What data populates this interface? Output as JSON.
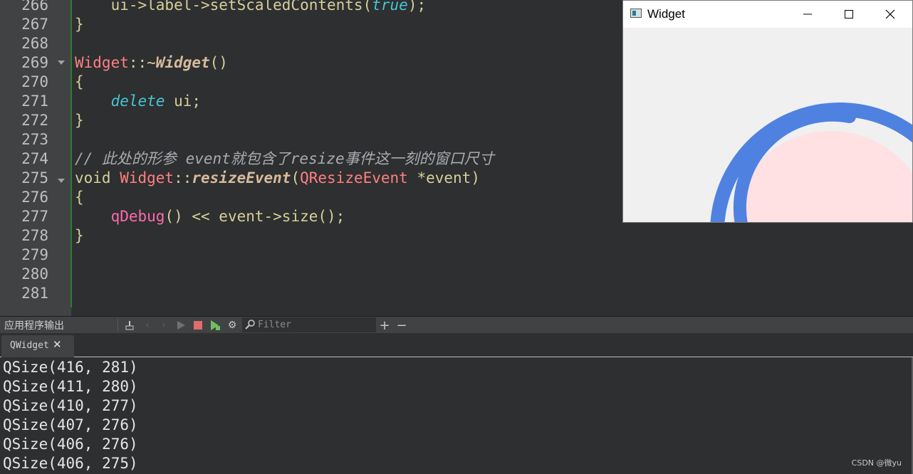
{
  "editor": {
    "line_numbers": [
      "266",
      "267",
      "268",
      "269",
      "270",
      "271",
      "272",
      "273",
      "274",
      "275",
      "276",
      "277",
      "278",
      "279",
      "280",
      "281"
    ],
    "lines": [
      [
        {
          "t": "    ui->label->setScaledContents(",
          "c": "plain"
        },
        {
          "t": "true",
          "c": "kw"
        },
        {
          "t": ");",
          "c": "plain"
        }
      ],
      [
        {
          "t": "}",
          "c": "plain"
        }
      ],
      [],
      [
        {
          "t": "Widget",
          "c": "type"
        },
        {
          "t": "::~",
          "c": "plain"
        },
        {
          "t": "Widget",
          "c": "fn"
        },
        {
          "t": "()",
          "c": "plain"
        }
      ],
      [
        {
          "t": "{",
          "c": "plain"
        }
      ],
      [
        {
          "t": "    ",
          "c": "plain"
        },
        {
          "t": "delete",
          "c": "kw"
        },
        {
          "t": " ui;",
          "c": "plain"
        }
      ],
      [
        {
          "t": "}",
          "c": "plain"
        }
      ],
      [],
      [
        {
          "t": "// 此处的形参 event就包含了resize事件这一刻的窗口尺寸",
          "c": "comment"
        }
      ],
      [
        {
          "t": "void ",
          "c": "plain"
        },
        {
          "t": "Widget",
          "c": "type"
        },
        {
          "t": "::",
          "c": "plain"
        },
        {
          "t": "resizeEvent",
          "c": "fn"
        },
        {
          "t": "(",
          "c": "plain"
        },
        {
          "t": "QResizeEvent",
          "c": "type"
        },
        {
          "t": " *event)",
          "c": "plain"
        }
      ],
      [
        {
          "t": "{",
          "c": "plain"
        }
      ],
      [
        {
          "t": "    ",
          "c": "plain"
        },
        {
          "t": "qDebug",
          "c": "fncall"
        },
        {
          "t": "() << event->size();",
          "c": "plain"
        }
      ],
      [
        {
          "t": "}",
          "c": "plain"
        }
      ],
      [],
      [],
      []
    ]
  },
  "widget_window": {
    "title": "Widget",
    "minimize_icon": "minimize-icon",
    "maximize_icon": "maximize-icon",
    "close_icon": "close-icon"
  },
  "output_panel": {
    "title": "应用程序输出",
    "filter_placeholder": "Filter",
    "tab_label": "QWidget",
    "lines": [
      "QSize(416, 281)",
      "QSize(411, 280)",
      "QSize(410, 277)",
      "QSize(407, 276)",
      "QSize(406, 276)",
      "QSize(406, 275)"
    ]
  },
  "watermark": "CSDN @微yu",
  "colors": {
    "editor_bg": "#2e2f30",
    "gutter_bg": "#404244",
    "keyword": "#45c6d6",
    "type": "#ff8080",
    "ring_blue": "#4f82e0",
    "pink_fill": "#ffe0e3"
  }
}
